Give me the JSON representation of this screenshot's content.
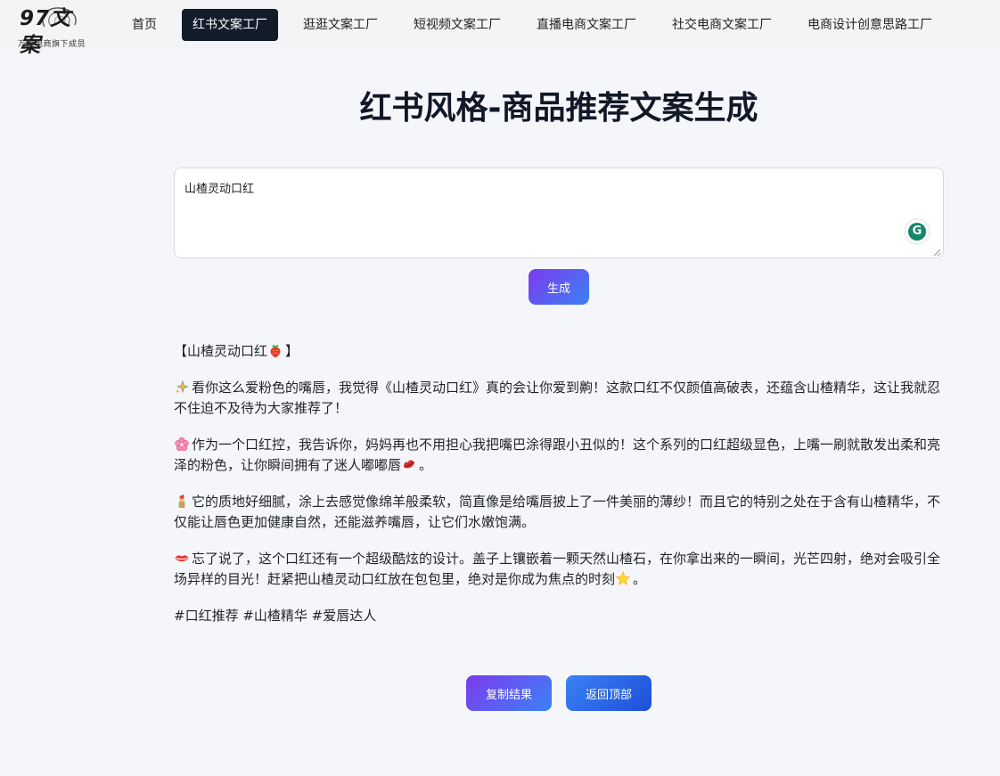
{
  "logo": {
    "brand": "97文案",
    "tagline": "万象电商旗下成员"
  },
  "nav": {
    "items": [
      {
        "label": "首页",
        "active": false
      },
      {
        "label": "红书文案工厂",
        "active": true
      },
      {
        "label": "逛逛文案工厂",
        "active": false
      },
      {
        "label": "短视频文案工厂",
        "active": false
      },
      {
        "label": "直播电商文案工厂",
        "active": false
      },
      {
        "label": "社交电商文案工厂",
        "active": false
      },
      {
        "label": "电商设计创意思路工厂",
        "active": false
      }
    ]
  },
  "page": {
    "title": "红书风格-商品推荐文案生成"
  },
  "input": {
    "value": "山楂灵动口红"
  },
  "buttons": {
    "generate": "生成",
    "copy": "复制结果",
    "back_to_top": "返回顶部"
  },
  "result": {
    "heading_pre": "【山楂灵动口红",
    "heading_post": "】",
    "p1": "看你这么爱粉色的嘴唇，我觉得《山楂灵动口红》真的会让你爱到齁！这款口红不仅颜值高破表，还蕴含山楂精华，这让我就忍不住迫不及待为大家推荐了！",
    "p2_pre": "作为一个口红控，我告诉你，妈妈再也不用担心我把嘴巴涂得跟小丑似的！这个系列的口红超级显色，上嘴一刷就散发出柔和亮泽的粉色，让你瞬间拥有了迷人嘟嘟唇",
    "p2_post": "。",
    "p3": "它的质地好细腻，涂上去感觉像绵羊般柔软，简直像是给嘴唇披上了一件美丽的薄纱！而且它的特别之处在于含有山楂精华，不仅能让唇色更加健康自然，还能滋养嘴唇，让它们水嫩饱满。",
    "p4_pre": "忘了说了，这个口红还有一个超级酷炫的设计。盖子上镶嵌着一颗天然山楂石，在你拿出来的一瞬间，光芒四射，绝对会吸引全场异样的目光！赶紧把山楂灵动口红放在包包里，绝对是你成为焦点的时刻",
    "p4_post": "。",
    "tags": "#口红推荐 #山楂精华 #爱唇达人"
  },
  "colors": {
    "nav_active_bg": "#141b2b",
    "primary_gradient_start": "#7c3aed",
    "primary_gradient_end": "#3b82f6",
    "grammarly_green": "#15876f"
  }
}
